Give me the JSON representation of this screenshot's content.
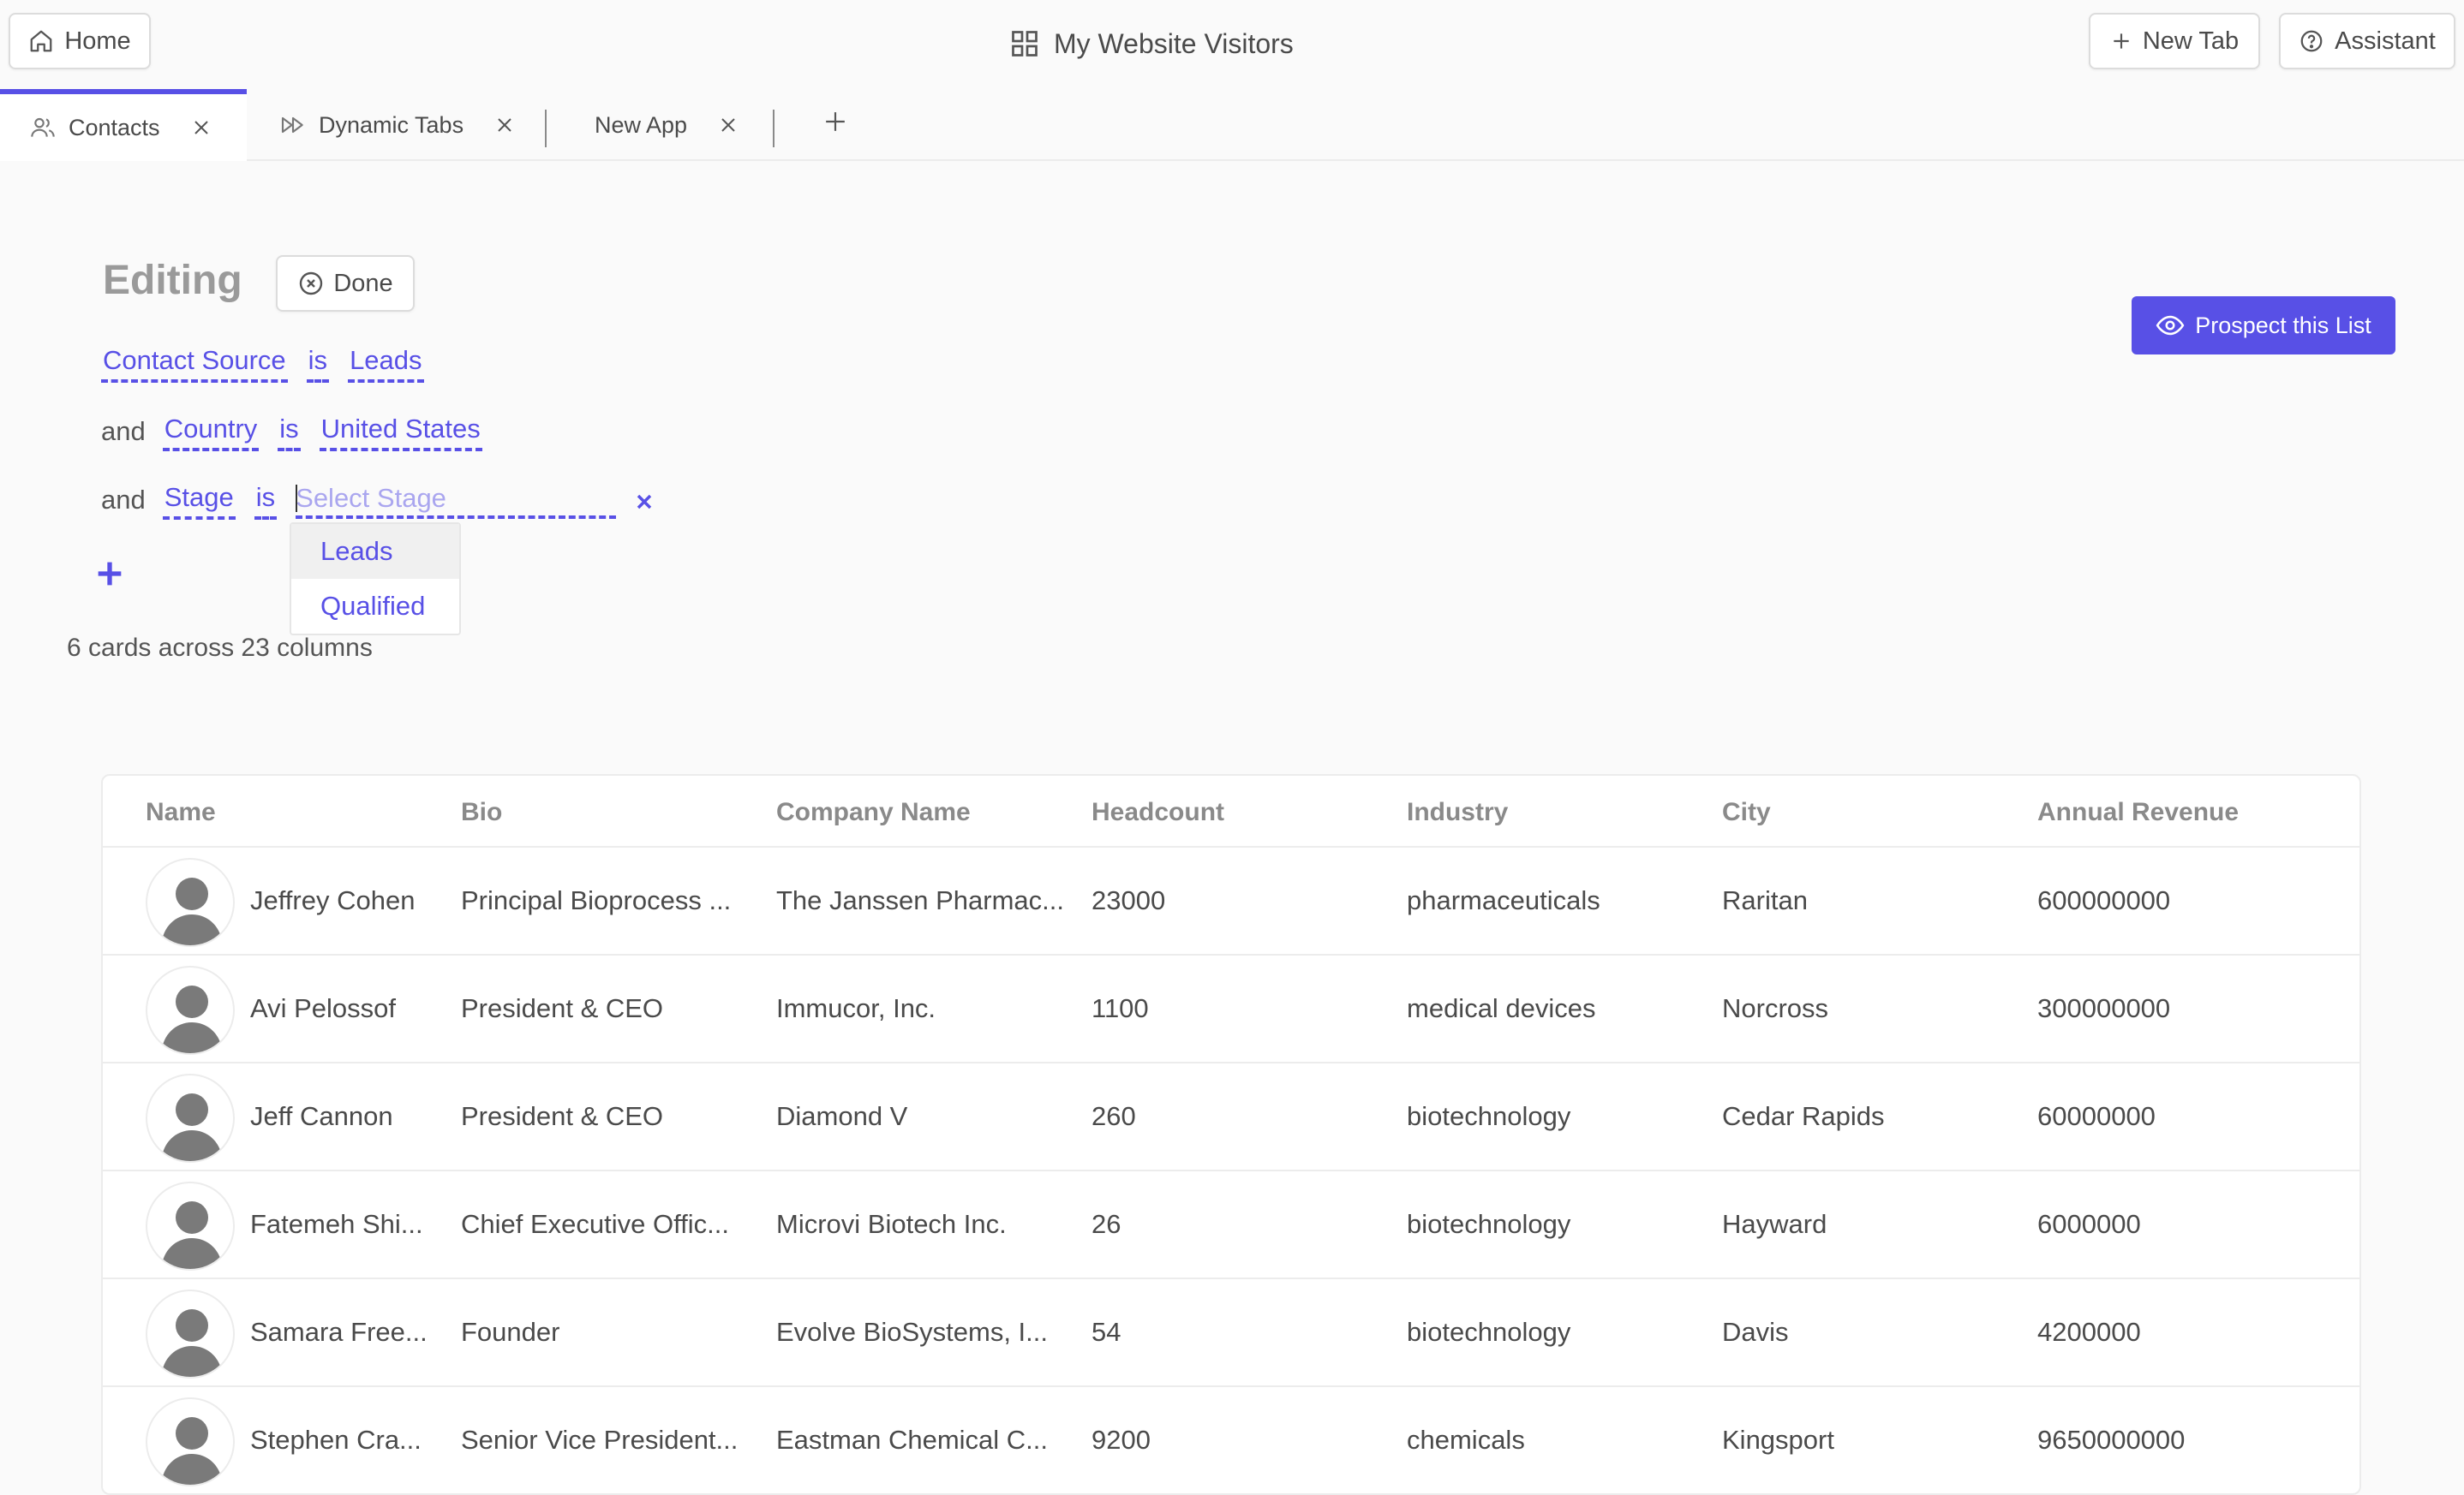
{
  "topbar": {
    "home_label": "Home",
    "app_title": "My Website Visitors",
    "new_tab_label": "New Tab",
    "assistant_label": "Assistant"
  },
  "tabs": [
    {
      "label": "Contacts",
      "icon": "contacts-icon",
      "active": true
    },
    {
      "label": "Dynamic Tabs",
      "icon": "fast-forward-icon",
      "active": false
    },
    {
      "label": "New App",
      "icon": "",
      "active": false
    }
  ],
  "editor": {
    "title": "Editing",
    "done_label": "Done",
    "filters": [
      {
        "conj": "",
        "field": "Contact Source",
        "op": "is",
        "value": "Leads"
      },
      {
        "conj": "and",
        "field": "Country",
        "op": "is",
        "value": "United States"
      },
      {
        "conj": "and",
        "field": "Stage",
        "op": "is",
        "value": "",
        "placeholder": "Select Stage"
      }
    ],
    "dropdown_options": [
      "Leads",
      "Qualified"
    ],
    "summary": "6 cards across 23 columns"
  },
  "prospect_button_label": "Prospect this List",
  "accent_color": "#5850e6",
  "table": {
    "columns": [
      "Name",
      "Bio",
      "Company Name",
      "Headcount",
      "Industry",
      "City",
      "Annual Revenue"
    ],
    "rows": [
      [
        "Jeffrey Cohen",
        "Principal Bioprocess ...",
        "The Janssen Pharmac...",
        "23000",
        "pharmaceuticals",
        "Raritan",
        "600000000"
      ],
      [
        "Avi Pelossof",
        "President & CEO",
        "Immucor, Inc.",
        "1100",
        "medical devices",
        "Norcross",
        "300000000"
      ],
      [
        "Jeff Cannon",
        "President & CEO",
        "Diamond V",
        "260",
        "biotechnology",
        "Cedar Rapids",
        "60000000"
      ],
      [
        "Fatemeh Shi...",
        "Chief Executive Offic...",
        "Microvi Biotech Inc.",
        "26",
        "biotechnology",
        "Hayward",
        "6000000"
      ],
      [
        "Samara Free...",
        "Founder",
        "Evolve BioSystems, I...",
        "54",
        "biotechnology",
        "Davis",
        "4200000"
      ],
      [
        "Stephen Cra...",
        "Senior Vice President...",
        "Eastman Chemical C...",
        "9200",
        "chemicals",
        "Kingsport",
        "9650000000"
      ]
    ]
  }
}
